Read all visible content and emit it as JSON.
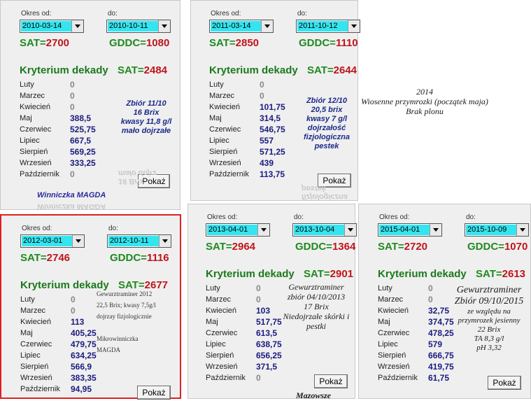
{
  "panels": [
    {
      "okres_od_label": "Okres od:",
      "do_label": "do:",
      "date_from": "2010-03-14",
      "date_to": "2010-10-11",
      "sat_label": "SAT=",
      "sat_value": "2700",
      "gddc_label": "GDDC=",
      "gddc_value": "1080",
      "kryterium_label": "Kryterium dekady",
      "sat2_label": "SAT=",
      "sat2_value": "2484",
      "months": [
        {
          "name": "Luty",
          "value": "0"
        },
        {
          "name": "Marzec",
          "value": "0"
        },
        {
          "name": "Kwiecień",
          "value": "0"
        },
        {
          "name": "Maj",
          "value": "388,5"
        },
        {
          "name": "Czerwiec",
          "value": "525,75"
        },
        {
          "name": "Lipiec",
          "value": "667,5"
        },
        {
          "name": "Sierpień",
          "value": "569,25"
        },
        {
          "name": "Wrzesień",
          "value": "333,25"
        },
        {
          "name": "Październik",
          "value": "0"
        }
      ],
      "button": "Pokaż",
      "note_lines": [
        "Zbiór 11/10",
        "16 Brix",
        "kwasy 11,8 g/l",
        "mało dojrzałe"
      ],
      "footer": "Winniczka MAGDA",
      "ghost_lines": [
        "Winniczka MAGDA",
        "16 Brix",
        "mało dojrz"
      ]
    },
    {
      "okres_od_label": "Okres od:",
      "do_label": "do:",
      "date_from": "2011-03-14",
      "date_to": "2011-10-12",
      "sat_label": "SAT=",
      "sat_value": "2850",
      "gddc_label": "GDDC=",
      "gddc_value": "1110",
      "kryterium_label": "Kryterium dekady",
      "sat2_label": "SAT=",
      "sat2_value": "2644",
      "months": [
        {
          "name": "Luty",
          "value": "0"
        },
        {
          "name": "Marzec",
          "value": "0"
        },
        {
          "name": "Kwiecień",
          "value": "101,75"
        },
        {
          "name": "Maj",
          "value": "314,5"
        },
        {
          "name": "Czerwiec",
          "value": "546,75"
        },
        {
          "name": "Lipiec",
          "value": "557"
        },
        {
          "name": "Sierpień",
          "value": "571,25"
        },
        {
          "name": "Wrzesień",
          "value": "439"
        },
        {
          "name": "Październik",
          "value": "113,75"
        }
      ],
      "button": "Pokaż",
      "note_lines": [
        "Zbiór 12/10",
        "20,5 brix",
        "kwasy 7 g/l",
        "dojrzałość",
        "fizjologiczna",
        "pestek"
      ],
      "ghost_lines": [
        "fizjologiczna",
        "pestek"
      ]
    },
    {
      "okres_od_label": "Okres od:",
      "do_label": "do:",
      "date_from": "2012-03-01",
      "date_to": "2012-10-11",
      "sat_label": "SAT=",
      "sat_value": "2746",
      "gddc_label": "GDDC=",
      "gddc_value": "1116",
      "kryterium_label": "Kryterium dekady",
      "sat2_label": "SAT=",
      "sat2_value": "2677",
      "months": [
        {
          "name": "Luty",
          "value": "0"
        },
        {
          "name": "Marzec",
          "value": "0"
        },
        {
          "name": "Kwiecień",
          "value": "113"
        },
        {
          "name": "Maj",
          "value": "405,25"
        },
        {
          "name": "Czerwiec",
          "value": "479,75"
        },
        {
          "name": "Lipiec",
          "value": "634,25"
        },
        {
          "name": "Sierpień",
          "value": "566,9"
        },
        {
          "name": "Wrzesień",
          "value": "383,35"
        },
        {
          "name": "Październik",
          "value": "94,95"
        }
      ],
      "button": "Pokaż",
      "note_lines": [
        "Gewurztraminer 2012",
        "22,5 Brix; kwasy 7,5g/l",
        "dojrzay fizjologicznie",
        "",
        "Mikrowinniczka",
        "MAGDA"
      ]
    },
    {
      "okres_od_label": "Okres od:",
      "do_label": "do:",
      "date_from": "2013-04-01",
      "date_to": "2013-10-04",
      "sat_label": "SAT=",
      "sat_value": "2964",
      "gddc_label": "GDDC=",
      "gddc_value": "1364",
      "kryterium_label": "Kryterium dekady",
      "sat2_label": "SAT=",
      "sat2_value": "2901",
      "months": [
        {
          "name": "Luty",
          "value": "0"
        },
        {
          "name": "Marzec",
          "value": "0"
        },
        {
          "name": "Kwiecień",
          "value": "103"
        },
        {
          "name": "Maj",
          "value": "517,75"
        },
        {
          "name": "Czerwiec",
          "value": "613,5"
        },
        {
          "name": "Lipiec",
          "value": "638,75"
        },
        {
          "name": "Sierpień",
          "value": "656,25"
        },
        {
          "name": "Wrzesień",
          "value": "371,5"
        },
        {
          "name": "Październik",
          "value": "0"
        }
      ],
      "button": "Pokaż",
      "note_lines": [
        "Gewurztraminer",
        "zbiór 04/10/2013",
        "17 Brix",
        "Niedojrzałe skórki i",
        "pestki"
      ],
      "footer": "Mazowsze"
    },
    {
      "okres_od_label": "Okres od:",
      "do_label": "do:",
      "date_from": "2015-04-01",
      "date_to": "2015-10-09",
      "sat_label": "SAT=",
      "sat_value": "2720",
      "gddc_label": "GDDC=",
      "gddc_value": "1070",
      "kryterium_label": "Kryterium dekady",
      "sat2_label": "SAT=",
      "sat2_value": "2613",
      "months": [
        {
          "name": "Luty",
          "value": "0"
        },
        {
          "name": "Marzec",
          "value": "0"
        },
        {
          "name": "Kwiecień",
          "value": "32,75"
        },
        {
          "name": "Maj",
          "value": "374,75"
        },
        {
          "name": "Czerwiec",
          "value": "478,25"
        },
        {
          "name": "Lipiec",
          "value": "579"
        },
        {
          "name": "Sierpień",
          "value": "666,75"
        },
        {
          "name": "Wrzesień",
          "value": "419,75"
        },
        {
          "name": "Październik",
          "value": "61,75"
        }
      ],
      "button": "Pokaż",
      "note_lines": [
        "Gewurztraminer",
        "Zbiór 09/10/2015",
        "ze względu na",
        "przymrozek jesienny",
        "22 Brix",
        "TA 8,3 g/l",
        "pH 3,32"
      ]
    }
  ],
  "note_2014": [
    "2014",
    "Wiosenne przymrozki (początek maja)",
    "Brak plonu"
  ],
  "colors": {
    "accent_cyan": "#33e5f0",
    "sat_green": "#1f8a1f",
    "value_red": "#c0141a",
    "value_blue": "#1b1b80",
    "frame_red": "#e02020"
  }
}
